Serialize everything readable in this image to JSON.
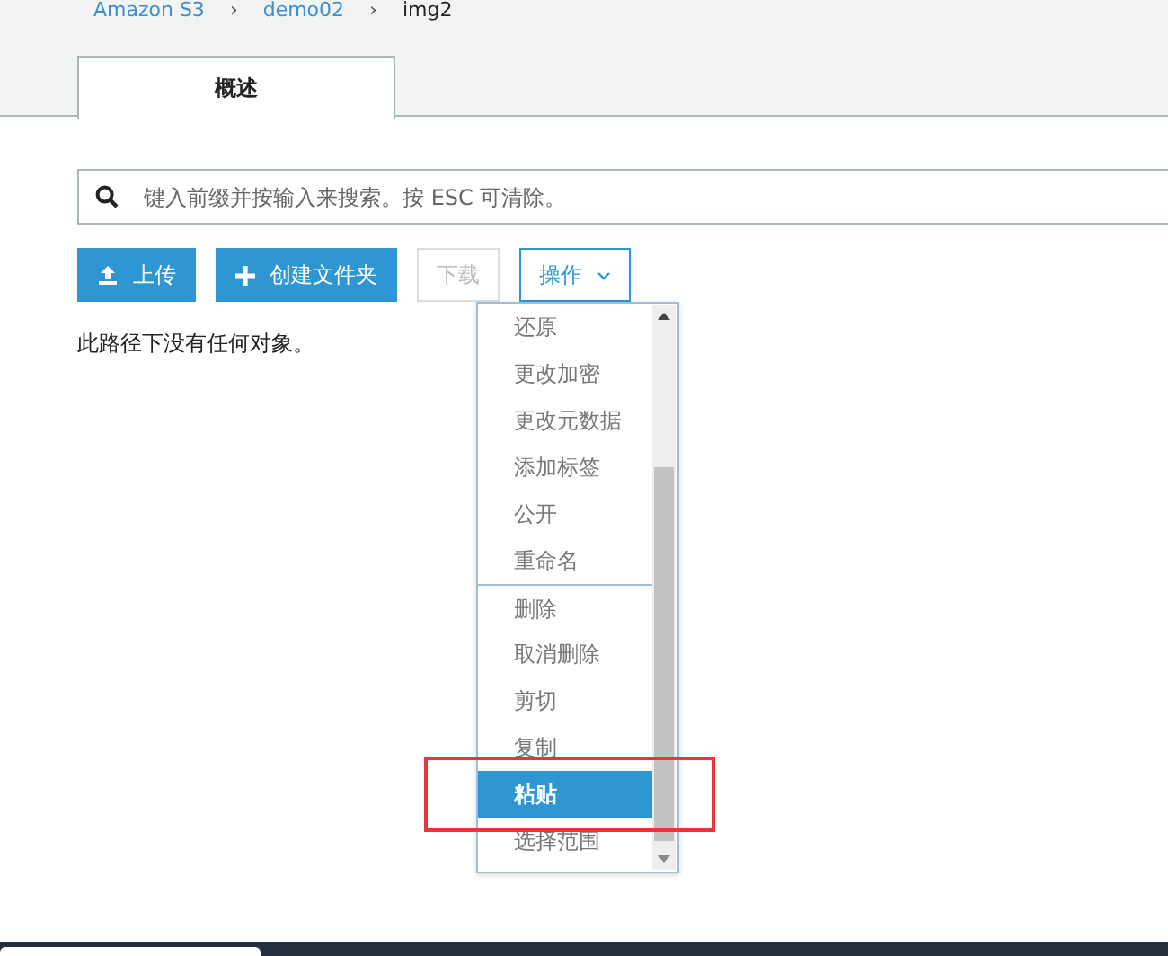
{
  "breadcrumb": [
    {
      "label": "Amazon S3",
      "link": true
    },
    {
      "separator": "›"
    },
    {
      "label": "demo02",
      "link": true
    },
    {
      "separator": "›"
    },
    {
      "label": "img2",
      "link": false
    }
  ],
  "tabs": [
    {
      "label": "概述",
      "selected": true
    }
  ],
  "search": {
    "placeholder": "键入前缀并按输入来搜索。按 ESC 可清除。"
  },
  "buttons": [
    {
      "label": "上传",
      "kind": "upload",
      "disabled": false
    },
    {
      "label": "创建文件夹",
      "kind": "create",
      "disabled": false
    },
    {
      "label": "下载",
      "kind": "plain",
      "disabled": true
    },
    {
      "label": "操作",
      "kind": "dropdown",
      "disabled": false
    }
  ],
  "empty_message": "此路径下没有任何对象。",
  "menu": {
    "items": [
      {
        "label": "还原",
        "selected": false,
        "divider_before": false,
        "highlighted": false
      },
      {
        "label": "更改加密",
        "selected": false,
        "divider_before": false,
        "highlighted": false
      },
      {
        "label": "更改元数据",
        "selected": false,
        "divider_before": false,
        "highlighted": false
      },
      {
        "label": "添加标签",
        "selected": false,
        "divider_before": false,
        "highlighted": false
      },
      {
        "label": "公开",
        "selected": false,
        "divider_before": false,
        "highlighted": false
      },
      {
        "label": "重命名",
        "selected": false,
        "divider_before": false,
        "highlighted": false
      },
      {
        "label": "删除",
        "selected": false,
        "divider_before": true,
        "highlighted": false
      },
      {
        "label": "取消删除",
        "selected": false,
        "divider_before": false,
        "highlighted": false
      },
      {
        "label": "剪切",
        "selected": false,
        "divider_before": false,
        "highlighted": false
      },
      {
        "label": "复制",
        "selected": false,
        "divider_before": false,
        "highlighted": false
      },
      {
        "label": "粘贴",
        "selected": true,
        "divider_before": false,
        "highlighted": true
      },
      {
        "label": "选择范围",
        "selected": false,
        "divider_before": false,
        "highlighted": false
      }
    ]
  }
}
